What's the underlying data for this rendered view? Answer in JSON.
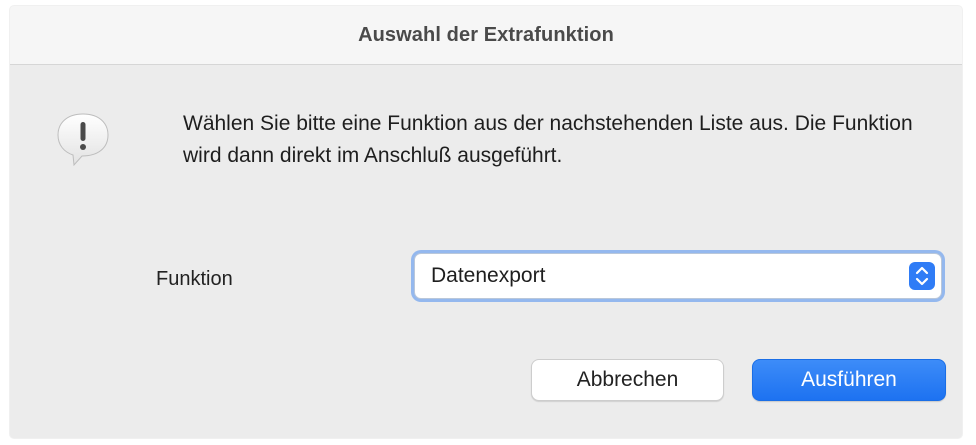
{
  "dialog": {
    "title": "Auswahl der Extrafunktion",
    "icon": "exclamation-speech-bubble-icon",
    "message": "Wählen Sie bitte eine Funktion aus der nachstehenden Liste aus. Die Funktion wird dann direkt im Anschluß ausgeführt.",
    "field_label": "Funktion",
    "select_value": "Datenexport",
    "cancel_label": "Abbrechen",
    "run_label": "Ausführen"
  },
  "colors": {
    "accent": "#2f7cf6",
    "focus_ring": "#94b8ee",
    "window_bg": "#ececec"
  }
}
